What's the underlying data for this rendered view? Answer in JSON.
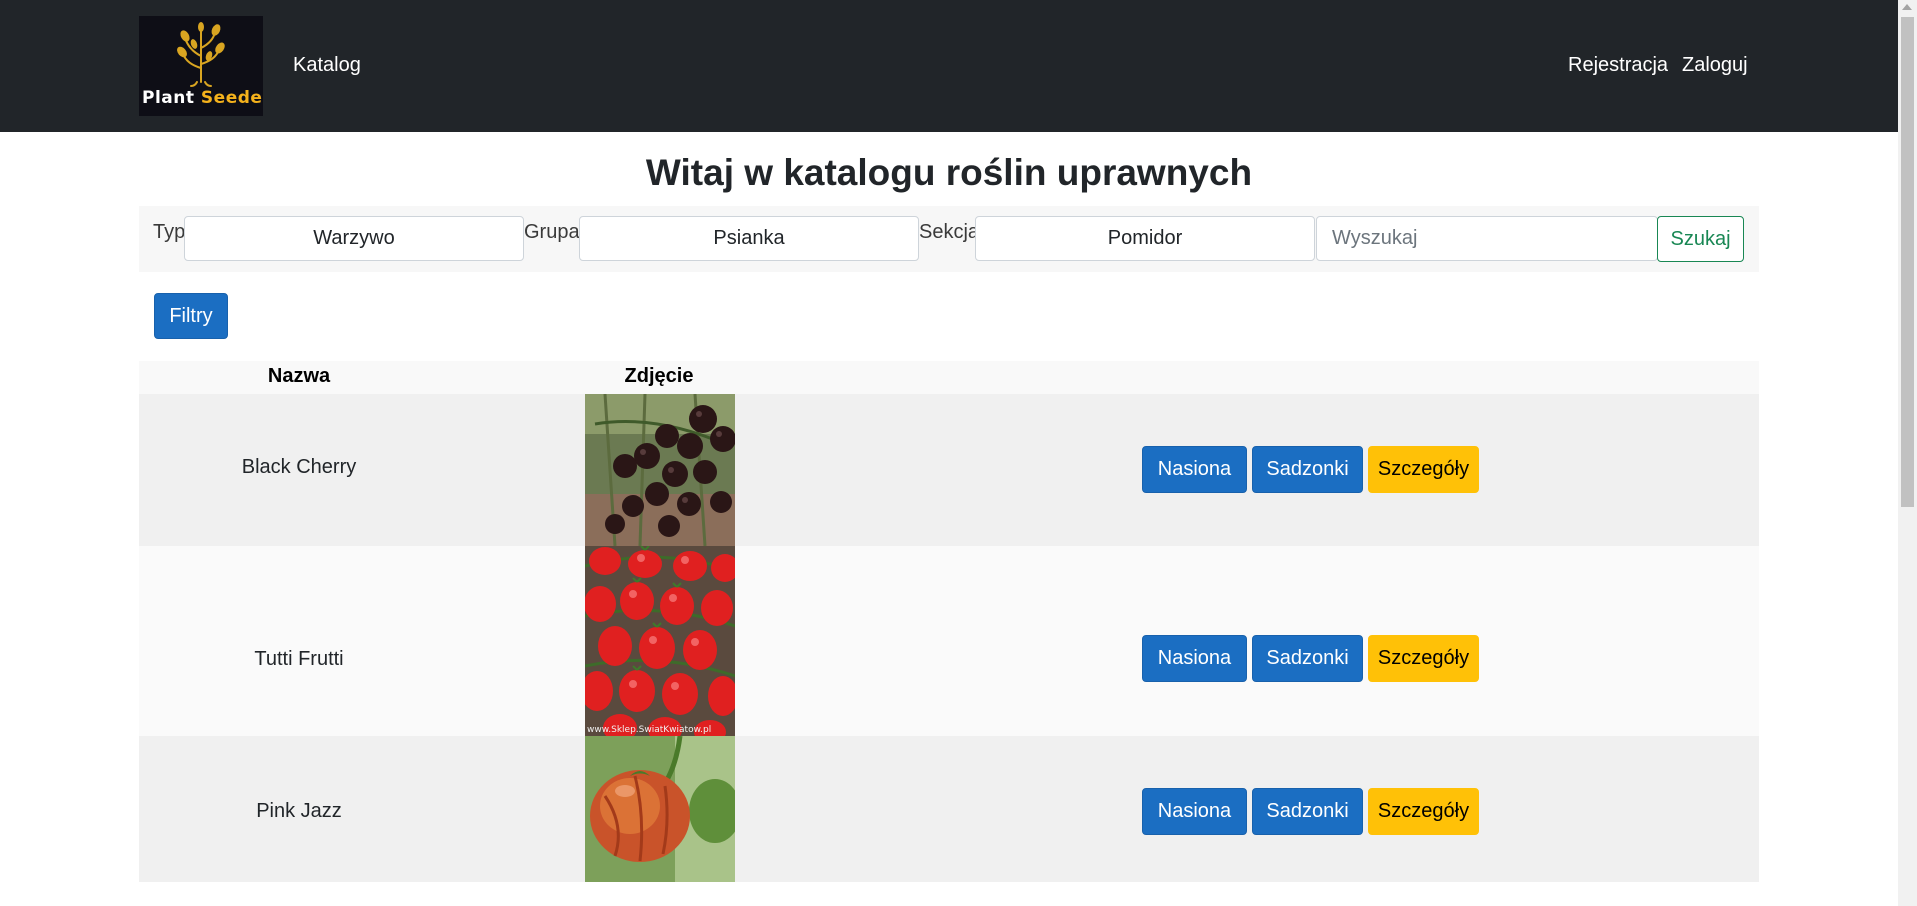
{
  "nav": {
    "logo_word_1": "Plant",
    "logo_word_2": "Seeder",
    "katalog": "Katalog",
    "register": "Rejestracja",
    "login": "Zaloguj"
  },
  "page_title": "Witaj w katalogu roślin uprawnych",
  "filters": {
    "type_label": "Typ",
    "type_value": "Warzywo",
    "group_label": "Grupa",
    "group_value": "Psianka",
    "section_label": "Sekcja",
    "section_value": "Pomidor",
    "search_placeholder": "Wyszukaj",
    "search_button": "Szukaj",
    "filters_button": "Filtry"
  },
  "table": {
    "headers": {
      "name": "Nazwa",
      "photo": "Zdjęcie"
    },
    "rows": [
      {
        "name": "Black Cherry",
        "photo": "black-cherry-tomato-photo",
        "seeds": "Nasiona",
        "seedlings": "Sadzonki",
        "details": "Szczegóły"
      },
      {
        "name": "Tutti Frutti",
        "photo": "tutti-frutti-tomato-photo",
        "photo_watermark": "www.Sklep.SwiatKwiatow.pl",
        "seeds": "Nasiona",
        "seedlings": "Sadzonki",
        "details": "Szczegóły"
      },
      {
        "name": "Pink Jazz",
        "photo": "pink-jazz-tomato-photo",
        "seeds": "Nasiona",
        "seedlings": "Sadzonki",
        "details": "Szczegóły"
      }
    ]
  },
  "colors": {
    "navbar": "#212529",
    "primary": "#1b6ec2",
    "warning": "#ffc107",
    "success": "#198754"
  }
}
